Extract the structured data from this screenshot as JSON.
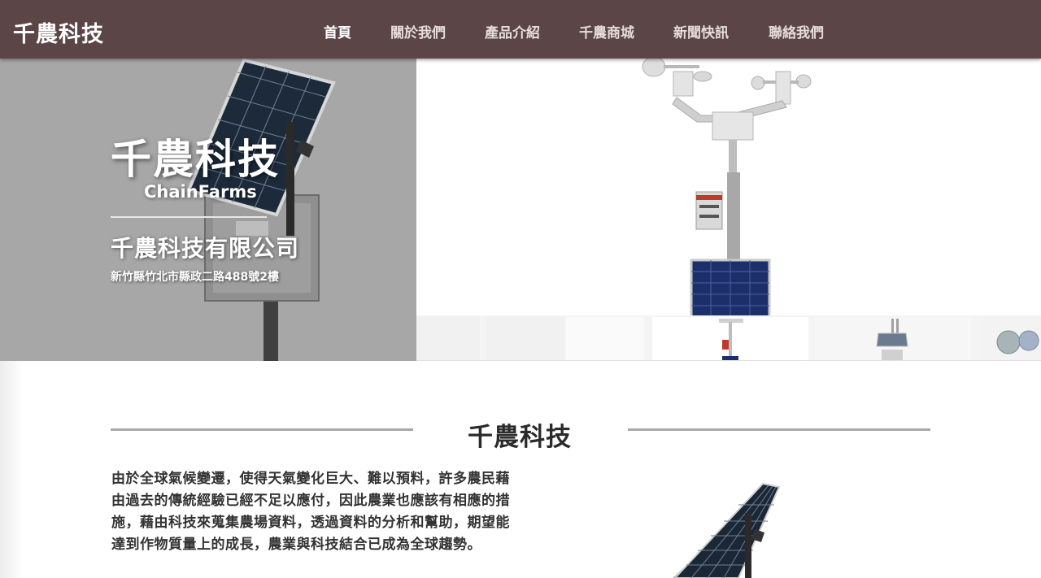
{
  "header": {
    "brand": "千農科技",
    "nav": [
      {
        "label": "首頁",
        "active": true
      },
      {
        "label": "關於我們"
      },
      {
        "label": "產品介紹"
      },
      {
        "label": "千農商城"
      },
      {
        "label": "新聞快訊"
      },
      {
        "label": "聯絡我們"
      }
    ]
  },
  "hero": {
    "title": "千農科技",
    "subtitle": "ChainFarms",
    "company": "千農科技有限公司",
    "address": "新竹縣竹北市縣政二路488號2樓"
  },
  "about": {
    "title": "千農科技",
    "paragraph": "由於全球氣候變遷，使得天氣變化巨大、難以預料，許多農民藉由過去的傳統經驗已經不足以應付，因此農業也應該有相應的措施，藉由科技來蒐集農場資料，透過資料的分析和幫助，期望能達到作物質量上的成長，農業與科技結合已成為全球趨勢。"
  },
  "colors": {
    "navbar": "#5b4546",
    "hero_left_bg": "#a7a7a7",
    "divider": "#a9a9a9"
  }
}
